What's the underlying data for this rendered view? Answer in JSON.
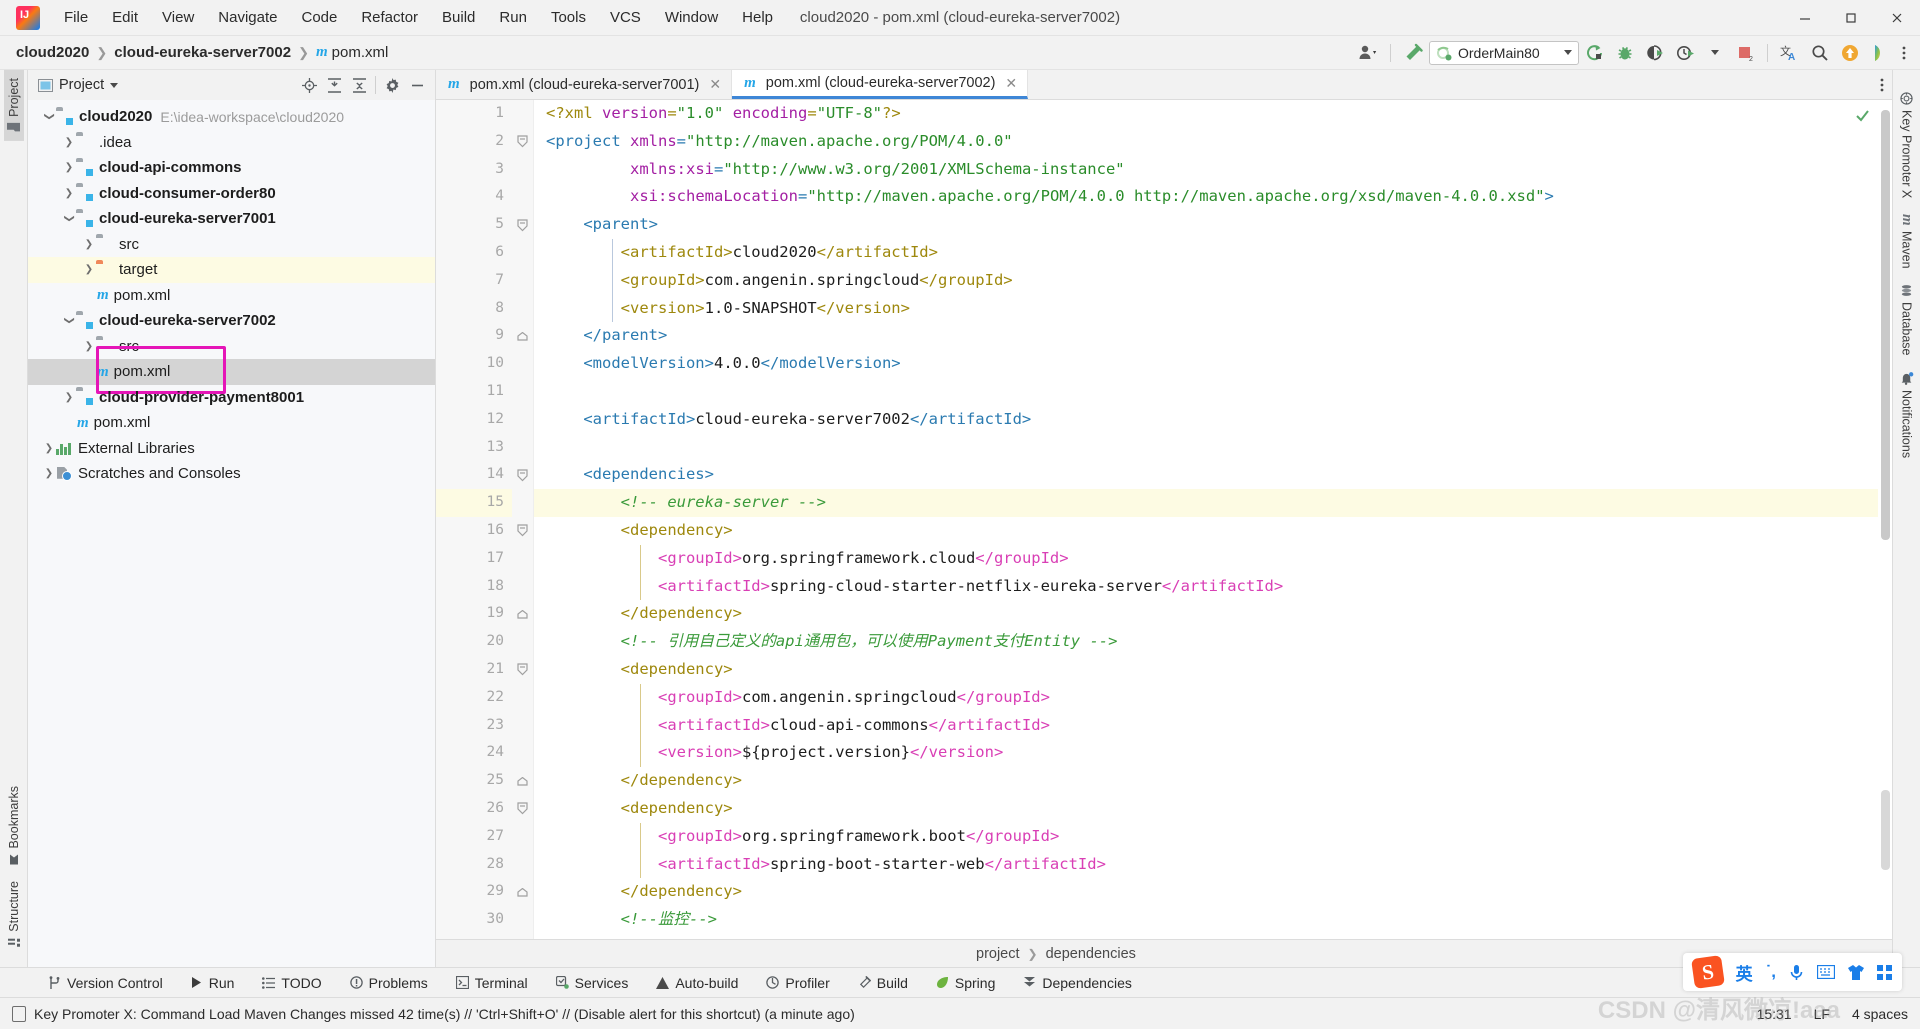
{
  "window": {
    "title": "cloud2020 - pom.xml (cloud-eureka-server7002)",
    "logo_icon": "intellij-idea-logo",
    "minimize_icon": "minimize-icon",
    "maximize_icon": "maximize-icon",
    "close_icon": "close-icon"
  },
  "menu": [
    {
      "label": "File"
    },
    {
      "label": "Edit"
    },
    {
      "label": "View"
    },
    {
      "label": "Navigate"
    },
    {
      "label": "Code"
    },
    {
      "label": "Refactor"
    },
    {
      "label": "Build"
    },
    {
      "label": "Run"
    },
    {
      "label": "Tools"
    },
    {
      "label": "VCS"
    },
    {
      "label": "Window"
    },
    {
      "label": "Help"
    }
  ],
  "navbar": {
    "crumbs": [
      "cloud2020",
      "cloud-eureka-server7002",
      "pom.xml"
    ],
    "file_icon": "maven-m-icon",
    "run_config": "OrderMain80",
    "icons": [
      "user-avatar-icon",
      "hammer-build-icon",
      "run-icon",
      "debug-icon",
      "run-with-coverage-icon",
      "profile-icon",
      "stop-icon",
      "translate-icon",
      "search-everywhere-icon",
      "update-icon",
      "ide-feature-icon"
    ]
  },
  "left_tool_tabs": [
    {
      "label": "Project",
      "icon": "project-folder-icon",
      "selected": true
    },
    {
      "label": "Bookmarks",
      "icon": "bookmark-icon",
      "selected": false
    },
    {
      "label": "Structure",
      "icon": "structure-icon",
      "selected": false
    }
  ],
  "right_tool_tabs": [
    {
      "label": "Key Promoter X",
      "icon": "key-promoter-icon"
    },
    {
      "label": "Maven",
      "icon": "maven-m-icon"
    },
    {
      "label": "Database",
      "icon": "database-icon"
    },
    {
      "label": "Notifications",
      "icon": "notifications-bell-icon"
    }
  ],
  "project_panel": {
    "title": "Project",
    "dropdown_icon": "chevron-down-icon",
    "toolbar_icons": [
      "locate-icon",
      "expand-all-icon",
      "collapse-all-icon",
      "settings-gear-icon",
      "hide-icon"
    ],
    "tree": [
      {
        "label": "cloud2020",
        "path": "E:\\idea-workspace\\cloud2020",
        "indent": 0,
        "twist": "expanded",
        "icon": "module-folder-icon",
        "bold": true
      },
      {
        "label": ".idea",
        "indent": 1,
        "twist": "collapsed",
        "icon": "folder-icon",
        "bold": false
      },
      {
        "label": "cloud-api-commons",
        "indent": 1,
        "twist": "collapsed",
        "icon": "module-folder-icon",
        "bold": true
      },
      {
        "label": "cloud-consumer-order80",
        "indent": 1,
        "twist": "collapsed",
        "icon": "module-folder-icon",
        "bold": true
      },
      {
        "label": "cloud-eureka-server7001",
        "indent": 1,
        "twist": "expanded",
        "icon": "module-folder-icon",
        "bold": true
      },
      {
        "label": "src",
        "indent": 2,
        "twist": "collapsed",
        "icon": "folder-icon",
        "bold": false
      },
      {
        "label": "target",
        "indent": 2,
        "twist": "collapsed",
        "icon": "excluded-folder-icon",
        "bold": false,
        "highlight": true
      },
      {
        "label": "pom.xml",
        "indent": 2,
        "twist": "none",
        "icon": "maven-m-icon",
        "bold": false
      },
      {
        "label": "cloud-eureka-server7002",
        "indent": 1,
        "twist": "expanded",
        "icon": "module-folder-icon",
        "bold": true
      },
      {
        "label": "src",
        "indent": 2,
        "twist": "collapsed",
        "icon": "folder-icon",
        "bold": false
      },
      {
        "label": "pom.xml",
        "indent": 2,
        "twist": "none",
        "icon": "maven-m-icon",
        "bold": false,
        "selected": true,
        "annotated": true
      },
      {
        "label": "cloud-provider-payment8001",
        "indent": 1,
        "twist": "collapsed",
        "icon": "module-folder-icon",
        "bold": true
      },
      {
        "label": "pom.xml",
        "indent": 1,
        "twist": "none",
        "icon": "maven-m-icon",
        "bold": false
      },
      {
        "label": "External Libraries",
        "indent": 0,
        "twist": "collapsed",
        "icon": "libraries-icon",
        "bold": false
      },
      {
        "label": "Scratches and Consoles",
        "indent": 0,
        "twist": "collapsed",
        "icon": "scratches-icon",
        "bold": false
      }
    ],
    "annotation_color": "#e515b7"
  },
  "editor": {
    "tabs": [
      {
        "label": "pom.xml (cloud-eureka-server7001)",
        "icon": "maven-m-icon",
        "active": false,
        "close_icon": "close-icon"
      },
      {
        "label": "pom.xml (cloud-eureka-server7002)",
        "icon": "maven-m-icon",
        "active": true,
        "close_icon": "close-icon"
      }
    ],
    "more_icon": "more-vertical-icon",
    "inspection_status_icon": "checkmark-ok-icon",
    "current_line": 15,
    "first_line": 1,
    "last_line": 30,
    "lines": [
      {
        "n": 1,
        "gutter": "",
        "fold": "",
        "tokens": [
          {
            "t": "pi",
            "v": "<?xml "
          },
          {
            "t": "attr",
            "v": "version"
          },
          {
            "t": "pi",
            "v": "="
          },
          {
            "t": "str",
            "v": "\"1.0\""
          },
          {
            "t": "pi",
            "v": " "
          },
          {
            "t": "attr",
            "v": "encoding"
          },
          {
            "t": "pi",
            "v": "="
          },
          {
            "t": "str",
            "v": "\"UTF-8\""
          },
          {
            "t": "pi",
            "v": "?>"
          }
        ]
      },
      {
        "n": 2,
        "gutter": "",
        "fold": "open",
        "tokens": [
          {
            "t": "tagblue",
            "v": "<project "
          },
          {
            "t": "attr",
            "v": "xmlns"
          },
          {
            "t": "tagblue",
            "v": "="
          },
          {
            "t": "str",
            "v": "\"http://maven.apache.org/POM/4.0.0\""
          }
        ]
      },
      {
        "n": 3,
        "gutter": "",
        "fold": "",
        "tokens": [
          {
            "t": "plain",
            "v": "         "
          },
          {
            "t": "attr",
            "v": "xmlns:xsi"
          },
          {
            "t": "tagblue",
            "v": "="
          },
          {
            "t": "str",
            "v": "\"http://www.w3.org/2001/XMLSchema-instance\""
          }
        ]
      },
      {
        "n": 4,
        "gutter": "",
        "fold": "",
        "tokens": [
          {
            "t": "plain",
            "v": "         "
          },
          {
            "t": "attr",
            "v": "xsi:schemaLocation"
          },
          {
            "t": "tagblue",
            "v": "="
          },
          {
            "t": "str",
            "v": "\"http://maven.apache.org/POM/4.0.0 http://maven.apache.org/xsd/maven-4.0.0.xsd\""
          },
          {
            "t": "tagblue",
            "v": ">"
          }
        ]
      },
      {
        "n": 5,
        "gutter": "maven-arrow",
        "fold": "open",
        "tokens": [
          {
            "t": "plain",
            "v": "    "
          },
          {
            "t": "tagblue",
            "v": "<parent>"
          }
        ]
      },
      {
        "n": 6,
        "gutter": "",
        "fold": "",
        "tokens": [
          {
            "t": "plain",
            "v": "        "
          },
          {
            "t": "tag",
            "v": "<artifactId>"
          },
          {
            "t": "txt",
            "v": "cloud2020"
          },
          {
            "t": "tag",
            "v": "</artifactId>"
          }
        ]
      },
      {
        "n": 7,
        "gutter": "",
        "fold": "",
        "tokens": [
          {
            "t": "plain",
            "v": "        "
          },
          {
            "t": "tag",
            "v": "<groupId>"
          },
          {
            "t": "txt",
            "v": "com.angenin.springcloud"
          },
          {
            "t": "tag",
            "v": "</groupId>"
          }
        ]
      },
      {
        "n": 8,
        "gutter": "",
        "fold": "",
        "tokens": [
          {
            "t": "plain",
            "v": "        "
          },
          {
            "t": "tag",
            "v": "<version>"
          },
          {
            "t": "txt",
            "v": "1.0-SNAPSHOT"
          },
          {
            "t": "tag",
            "v": "</version>"
          }
        ]
      },
      {
        "n": 9,
        "gutter": "",
        "fold": "close",
        "tokens": [
          {
            "t": "plain",
            "v": "    "
          },
          {
            "t": "tagblue",
            "v": "</parent>"
          }
        ]
      },
      {
        "n": 10,
        "gutter": "",
        "fold": "",
        "tokens": [
          {
            "t": "plain",
            "v": "    "
          },
          {
            "t": "tagblue",
            "v": "<modelVersion>"
          },
          {
            "t": "txt",
            "v": "4.0.0"
          },
          {
            "t": "tagblue",
            "v": "</modelVersion>"
          }
        ]
      },
      {
        "n": 11,
        "gutter": "",
        "fold": "",
        "tokens": [
          {
            "t": "plain",
            "v": ""
          }
        ]
      },
      {
        "n": 12,
        "gutter": "",
        "fold": "",
        "tokens": [
          {
            "t": "plain",
            "v": "    "
          },
          {
            "t": "tagblue",
            "v": "<artifactId>"
          },
          {
            "t": "txt",
            "v": "cloud-eureka-server7002"
          },
          {
            "t": "tagblue",
            "v": "</artifactId>"
          }
        ]
      },
      {
        "n": 13,
        "gutter": "",
        "fold": "",
        "tokens": [
          {
            "t": "plain",
            "v": ""
          }
        ]
      },
      {
        "n": 14,
        "gutter": "",
        "fold": "open",
        "tokens": [
          {
            "t": "plain",
            "v": "    "
          },
          {
            "t": "tagblue",
            "v": "<dependencies>"
          }
        ]
      },
      {
        "n": 15,
        "gutter": "intention-bulb",
        "fold": "",
        "current": true,
        "tokens": [
          {
            "t": "plain",
            "v": "        "
          },
          {
            "t": "cmt",
            "v": "<!-- eureka-server -->"
          }
        ]
      },
      {
        "n": 16,
        "gutter": "maven-dep-arrow",
        "fold": "open",
        "tokens": [
          {
            "t": "plain",
            "v": "        "
          },
          {
            "t": "tag",
            "v": "<dependency>"
          }
        ]
      },
      {
        "n": 17,
        "gutter": "",
        "fold": "",
        "tokens": [
          {
            "t": "plain",
            "v": "            "
          },
          {
            "t": "tag2",
            "v": "<groupId>"
          },
          {
            "t": "txt",
            "v": "org.springframework.cloud"
          },
          {
            "t": "tag2",
            "v": "</groupId>"
          }
        ]
      },
      {
        "n": 18,
        "gutter": "",
        "fold": "",
        "tokens": [
          {
            "t": "plain",
            "v": "            "
          },
          {
            "t": "tag2",
            "v": "<artifactId>"
          },
          {
            "t": "txt",
            "v": "spring-cloud-starter-netflix-eureka-server"
          },
          {
            "t": "tag2",
            "v": "</artifactId>"
          }
        ]
      },
      {
        "n": 19,
        "gutter": "",
        "fold": "close",
        "tokens": [
          {
            "t": "plain",
            "v": "        "
          },
          {
            "t": "tag",
            "v": "</dependency>"
          }
        ]
      },
      {
        "n": 20,
        "gutter": "",
        "fold": "",
        "tokens": [
          {
            "t": "plain",
            "v": "        "
          },
          {
            "t": "cmt",
            "v": "<!-- 引用自己定义的api通用包，可以使用Payment支付Entity -->"
          }
        ]
      },
      {
        "n": 21,
        "gutter": "",
        "fold": "open",
        "tokens": [
          {
            "t": "plain",
            "v": "        "
          },
          {
            "t": "tag",
            "v": "<dependency>"
          }
        ]
      },
      {
        "n": 22,
        "gutter": "",
        "fold": "",
        "tokens": [
          {
            "t": "plain",
            "v": "            "
          },
          {
            "t": "tag2",
            "v": "<groupId>"
          },
          {
            "t": "txt",
            "v": "com.angenin.springcloud"
          },
          {
            "t": "tag2",
            "v": "</groupId>"
          }
        ]
      },
      {
        "n": 23,
        "gutter": "",
        "fold": "",
        "tokens": [
          {
            "t": "plain",
            "v": "            "
          },
          {
            "t": "tag2",
            "v": "<artifactId>"
          },
          {
            "t": "txt",
            "v": "cloud-api-commons"
          },
          {
            "t": "tag2",
            "v": "</artifactId>"
          }
        ]
      },
      {
        "n": 24,
        "gutter": "",
        "fold": "",
        "tokens": [
          {
            "t": "plain",
            "v": "            "
          },
          {
            "t": "tag2",
            "v": "<version>"
          },
          {
            "t": "txt",
            "v": "${project.version}"
          },
          {
            "t": "tag2",
            "v": "</version>"
          }
        ]
      },
      {
        "n": 25,
        "gutter": "",
        "fold": "close",
        "tokens": [
          {
            "t": "plain",
            "v": "        "
          },
          {
            "t": "tag",
            "v": "</dependency>"
          }
        ]
      },
      {
        "n": 26,
        "gutter": "maven-dep-arrow",
        "fold": "open",
        "tokens": [
          {
            "t": "plain",
            "v": "        "
          },
          {
            "t": "tag",
            "v": "<dependency>"
          }
        ]
      },
      {
        "n": 27,
        "gutter": "",
        "fold": "",
        "tokens": [
          {
            "t": "plain",
            "v": "            "
          },
          {
            "t": "tag2",
            "v": "<groupId>"
          },
          {
            "t": "txt",
            "v": "org.springframework.boot"
          },
          {
            "t": "tag2",
            "v": "</groupId>"
          }
        ]
      },
      {
        "n": 28,
        "gutter": "",
        "fold": "",
        "tokens": [
          {
            "t": "plain",
            "v": "            "
          },
          {
            "t": "tag2",
            "v": "<artifactId>"
          },
          {
            "t": "txt",
            "v": "spring-boot-starter-web"
          },
          {
            "t": "tag2",
            "v": "</artifactId>"
          }
        ]
      },
      {
        "n": 29,
        "gutter": "",
        "fold": "close",
        "tokens": [
          {
            "t": "plain",
            "v": "        "
          },
          {
            "t": "tag",
            "v": "</dependency>"
          }
        ]
      },
      {
        "n": 30,
        "gutter": "",
        "fold": "",
        "tokens": [
          {
            "t": "plain",
            "v": "        "
          },
          {
            "t": "cmt",
            "v": "<!--监控-->"
          }
        ]
      }
    ],
    "breadcrumb": [
      "project",
      "dependencies"
    ]
  },
  "bottom_toolwindows": [
    {
      "label": "Version Control",
      "icon": "branch-icon"
    },
    {
      "label": "Run",
      "icon": "run-icon"
    },
    {
      "label": "TODO",
      "icon": "todo-list-icon"
    },
    {
      "label": "Problems",
      "icon": "problems-icon"
    },
    {
      "label": "Terminal",
      "icon": "terminal-icon"
    },
    {
      "label": "Services",
      "icon": "services-icon"
    },
    {
      "label": "Auto-build",
      "icon": "auto-build-icon"
    },
    {
      "label": "Profiler",
      "icon": "profiler-icon"
    },
    {
      "label": "Build",
      "icon": "hammer-build-icon"
    },
    {
      "label": "Spring",
      "icon": "spring-leaf-icon"
    },
    {
      "label": "Dependencies",
      "icon": "dependencies-icon"
    }
  ],
  "statusbar": {
    "message": "Key Promoter X: Command Load Maven Changes missed 42 time(s) // 'Ctrl+Shift+O' // (Disable alert for this shortcut) (a minute ago)",
    "message_icon": "event-log-icon",
    "time": "15:31",
    "line_separator": "LF",
    "indent": "4 spaces",
    "watermark": "CSDN @清风微凉!aaa"
  },
  "ime_tray": {
    "app": "S",
    "items": [
      "英",
      "punctuation-icon",
      "microphone-icon",
      "keyboard-icon",
      "skin-icon",
      "apps-grid-icon"
    ]
  },
  "colors": {
    "accent": "#3e86d6",
    "annotation": "#e515b7",
    "tag": "#9e880d",
    "tag_nested": "#d93fb5",
    "string": "#2a8c2a",
    "comment": "#3a9a3a",
    "attribute": "#a31fa3",
    "tag_blue": "#2a7ab0"
  }
}
